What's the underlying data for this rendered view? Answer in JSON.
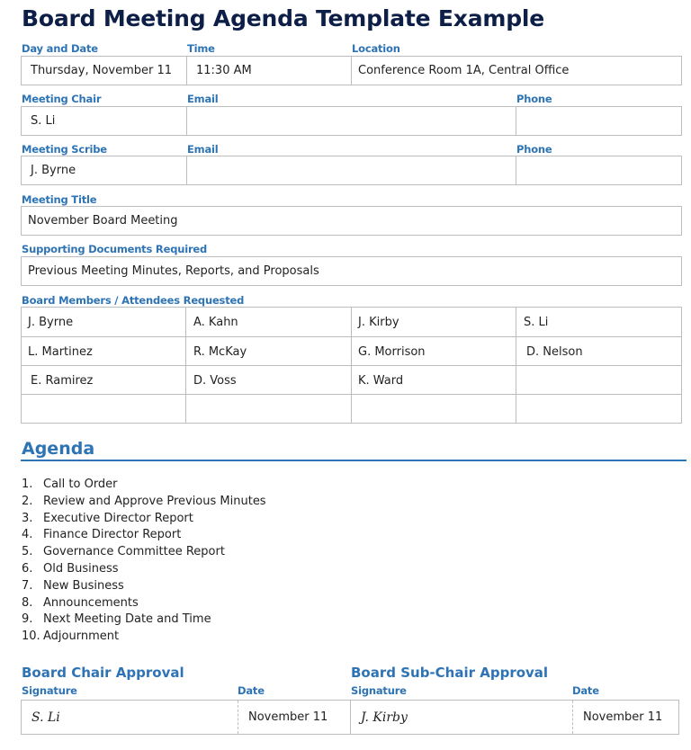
{
  "title": "Board Meeting Agenda Template Example",
  "meeting_info": {
    "day_date_label": "Day and Date",
    "day_date_value": "Thursday, November 11",
    "time_label": "Time",
    "time_value": "11:30 AM",
    "location_label": "Location",
    "location_value": "Conference Room 1A, Central Office"
  },
  "chair": {
    "label": "Meeting Chair",
    "value": "S. Li",
    "email_label": "Email",
    "email_value": "",
    "phone_label": "Phone",
    "phone_value": ""
  },
  "scribe": {
    "label": "Meeting Scribe",
    "value": "J. Byrne",
    "email_label": "Email",
    "email_value": "",
    "phone_label": "Phone",
    "phone_value": ""
  },
  "meeting_title": {
    "label": "Meeting Title",
    "value": "November Board Meeting"
  },
  "supporting_docs": {
    "label": "Supporting Documents Required",
    "value": "Previous Meeting Minutes, Reports, and Proposals"
  },
  "attendees": {
    "label": "Board Members / Attendees Requested",
    "rows": [
      [
        "J. Byrne",
        "A. Kahn",
        "J. Kirby",
        "S. Li"
      ],
      [
        "L. Martinez",
        "R. McKay",
        "G. Morrison",
        "D. Nelson"
      ],
      [
        "E. Ramirez",
        "D. Voss",
        "K. Ward",
        ""
      ],
      [
        "",
        "",
        "",
        ""
      ]
    ]
  },
  "agenda": {
    "heading": "Agenda",
    "items": [
      {
        "num": "1.",
        "text": "Call to Order"
      },
      {
        "num": "2.",
        "text": "Review and Approve Previous Minutes"
      },
      {
        "num": "3.",
        "text": "Executive Director Report"
      },
      {
        "num": "4.",
        "text": "Finance Director Report"
      },
      {
        "num": "5.",
        "text": "Governance Committee Report"
      },
      {
        "num": "6.",
        "text": "Old Business"
      },
      {
        "num": "7.",
        "text": "New Business"
      },
      {
        "num": "8.",
        "text": "Announcements"
      },
      {
        "num": "9.",
        "text": "Next Meeting Date and Time"
      },
      {
        "num": "10.",
        "text": "Adjournment"
      }
    ]
  },
  "chair_approval": {
    "heading": "Board Chair Approval",
    "signature_label": "Signature",
    "signature_value": "S. Li",
    "date_label": "Date",
    "date_value": "November 11"
  },
  "subchair_approval": {
    "heading": "Board Sub-Chair Approval",
    "signature_label": "Signature",
    "signature_value": "J. Kirby",
    "date_label": "Date",
    "date_value": "November 11"
  },
  "colors": {
    "title": "#0e1f47",
    "accent": "#2e74b5",
    "border": "#bdbdbd",
    "text": "#222222"
  }
}
